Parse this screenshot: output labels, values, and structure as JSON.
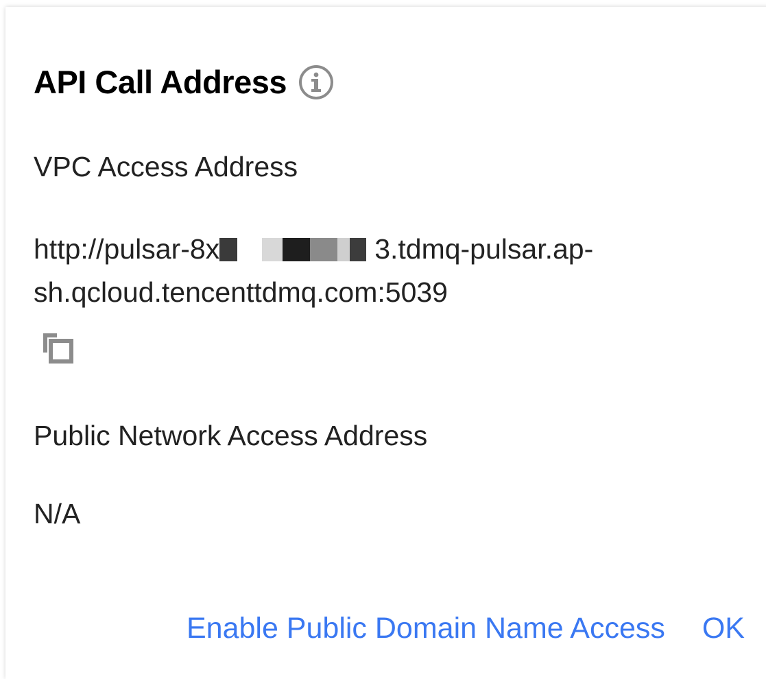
{
  "dialog": {
    "title": "API Call Address",
    "info_icon": "info-circle-icon",
    "vpc": {
      "label": "VPC Access Address",
      "value_prefix": "http://pulsar-8x",
      "value_suffix": "3.tdmq-pulsar.ap-sh.qcloud.tencenttdmq.com:5039",
      "copy_icon": "copy-icon"
    },
    "public": {
      "label": "Public Network Access Address",
      "value": "N/A"
    },
    "actions": {
      "enable_public": "Enable Public Domain Name Access",
      "ok": "OK"
    }
  },
  "colors": {
    "link": "#3a78f2",
    "text": "#222222",
    "icon": "#8c8c8c"
  }
}
